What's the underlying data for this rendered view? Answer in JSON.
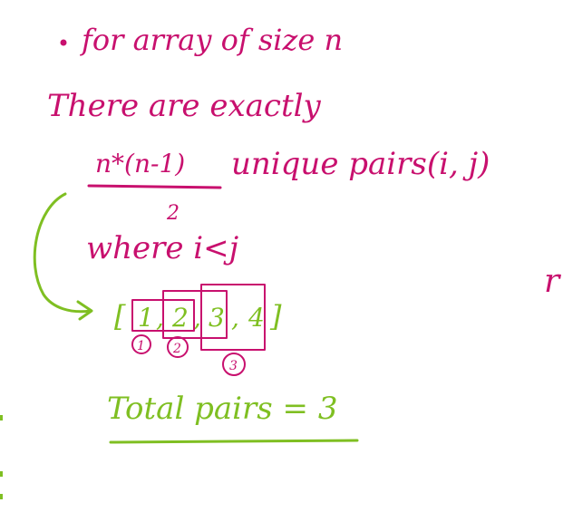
{
  "notes": {
    "line1": "• for array of size n",
    "line2": "There are exactly",
    "formula_numerator": "n*(n-1)",
    "formula_denominator": "2",
    "line3_suffix": "unique pairs(i, j)",
    "line4": "where i<j",
    "array": {
      "open_bracket": "[",
      "items": [
        "1",
        "2",
        "3",
        "4"
      ],
      "separator": ",",
      "close_bracket": "]"
    },
    "pair_markers": [
      "1",
      "2",
      "3"
    ],
    "total_label": "Total pairs = 3",
    "stray_mark": "r"
  },
  "colors": {
    "magenta": "#c8106e",
    "green": "#7fbf22",
    "background": "#ffffff"
  }
}
